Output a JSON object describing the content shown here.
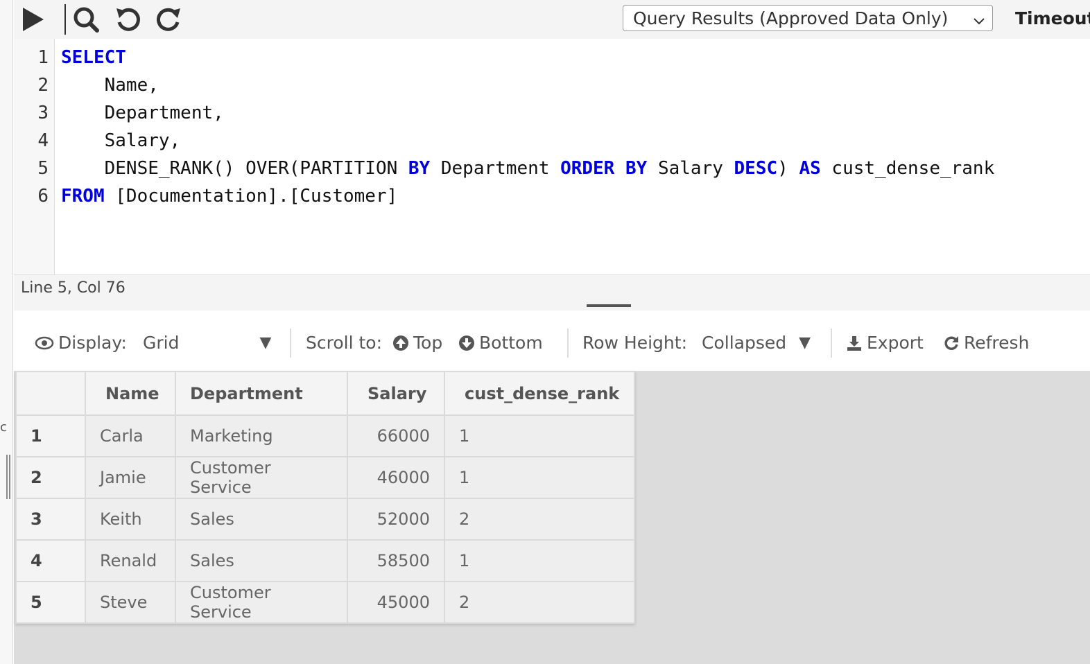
{
  "toolbar": {
    "run_icon": "play-icon",
    "search_icon": "search-icon",
    "undo_icon": "undo-icon",
    "redo_icon": "redo-icon",
    "result_mode": "Query Results (Approved Data Only)",
    "timeout_label": "Timeout"
  },
  "editor": {
    "line_numbers": [
      "1",
      "2",
      "3",
      "4",
      "5",
      "6"
    ]
  },
  "status": {
    "cursor": "Line 5, Col 76"
  },
  "results_toolbar": {
    "display_label": "Display:",
    "display_value": "Grid",
    "scroll_label": "Scroll to:",
    "top_label": "Top",
    "bottom_label": "Bottom",
    "row_height_label": "Row Height:",
    "row_height_value": "Collapsed",
    "export_label": "Export",
    "refresh_label": "Refresh"
  },
  "grid": {
    "columns": [
      "Name",
      "Department",
      "Salary",
      "cust_dense_rank"
    ],
    "rows": [
      {
        "num": "1",
        "name": "Carla",
        "department": "Marketing",
        "salary": "66000",
        "rank": "1"
      },
      {
        "num": "2",
        "name": "Jamie",
        "department": "Customer Service",
        "salary": "46000",
        "rank": "1"
      },
      {
        "num": "3",
        "name": "Keith",
        "department": "Sales",
        "salary": "52000",
        "rank": "2"
      },
      {
        "num": "4",
        "name": "Renald",
        "department": "Sales",
        "salary": "58500",
        "rank": "1"
      },
      {
        "num": "5",
        "name": "Steve",
        "department": "Customer Service",
        "salary": "45000",
        "rank": "2"
      }
    ]
  },
  "colors": {
    "keyword": "#0000dd",
    "results_bg": "#dcdcdc"
  }
}
